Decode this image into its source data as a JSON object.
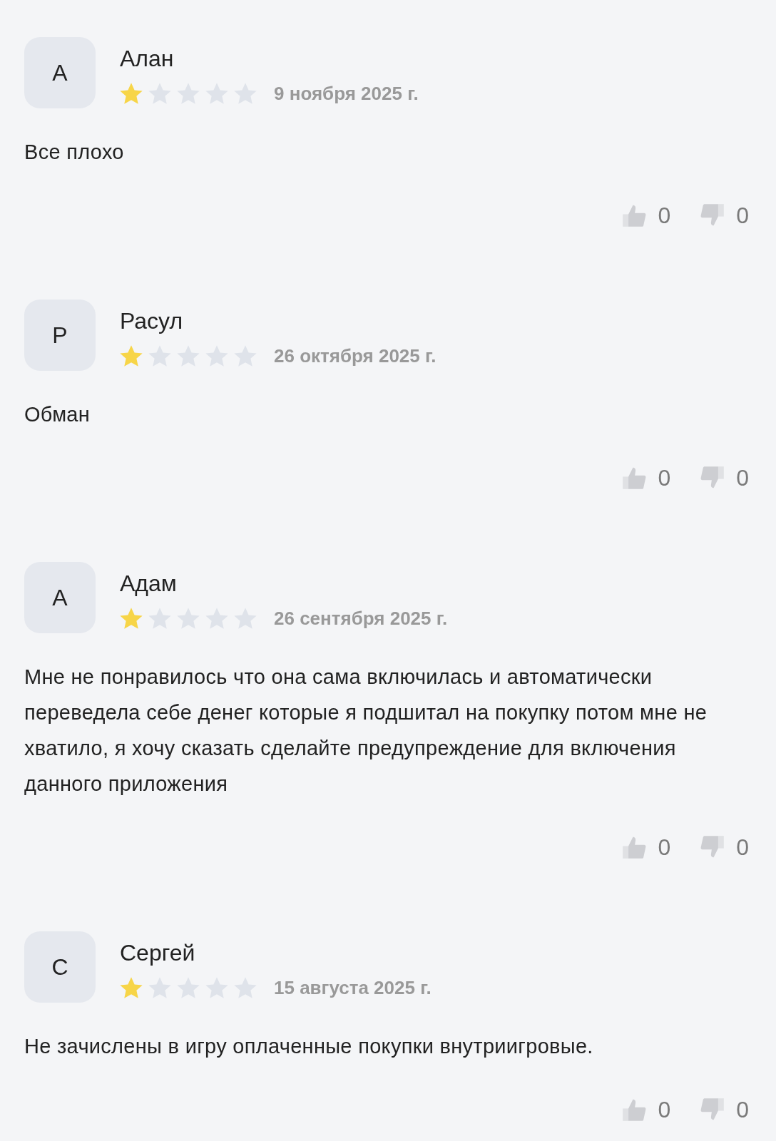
{
  "reviews": [
    {
      "avatar": "А",
      "name": "Алан",
      "stars": 1,
      "date": "9 ноября 2025 г.",
      "text": "Все плохо",
      "likes": "0",
      "dislikes": "0"
    },
    {
      "avatar": "Р",
      "name": "Расул",
      "stars": 1,
      "date": "26 октября 2025 г.",
      "text": "Обман",
      "likes": "0",
      "dislikes": "0"
    },
    {
      "avatar": "А",
      "name": "Адам",
      "stars": 1,
      "date": "26 сентября 2025 г.",
      "text": "Мне не понравилось что она сама включилась и автоматически переведела себе денег которые я подшитал на покупку потом мне не хватило, я хочу сказать сделайте предупреждение для включения данного приложения",
      "likes": "0",
      "dislikes": "0"
    },
    {
      "avatar": "С",
      "name": "Сергей",
      "stars": 1,
      "date": "15 августа 2025 г.",
      "text": "Не зачислены в игру оплаченные покупки внутриигровые.",
      "likes": "0",
      "dislikes": "0"
    }
  ]
}
